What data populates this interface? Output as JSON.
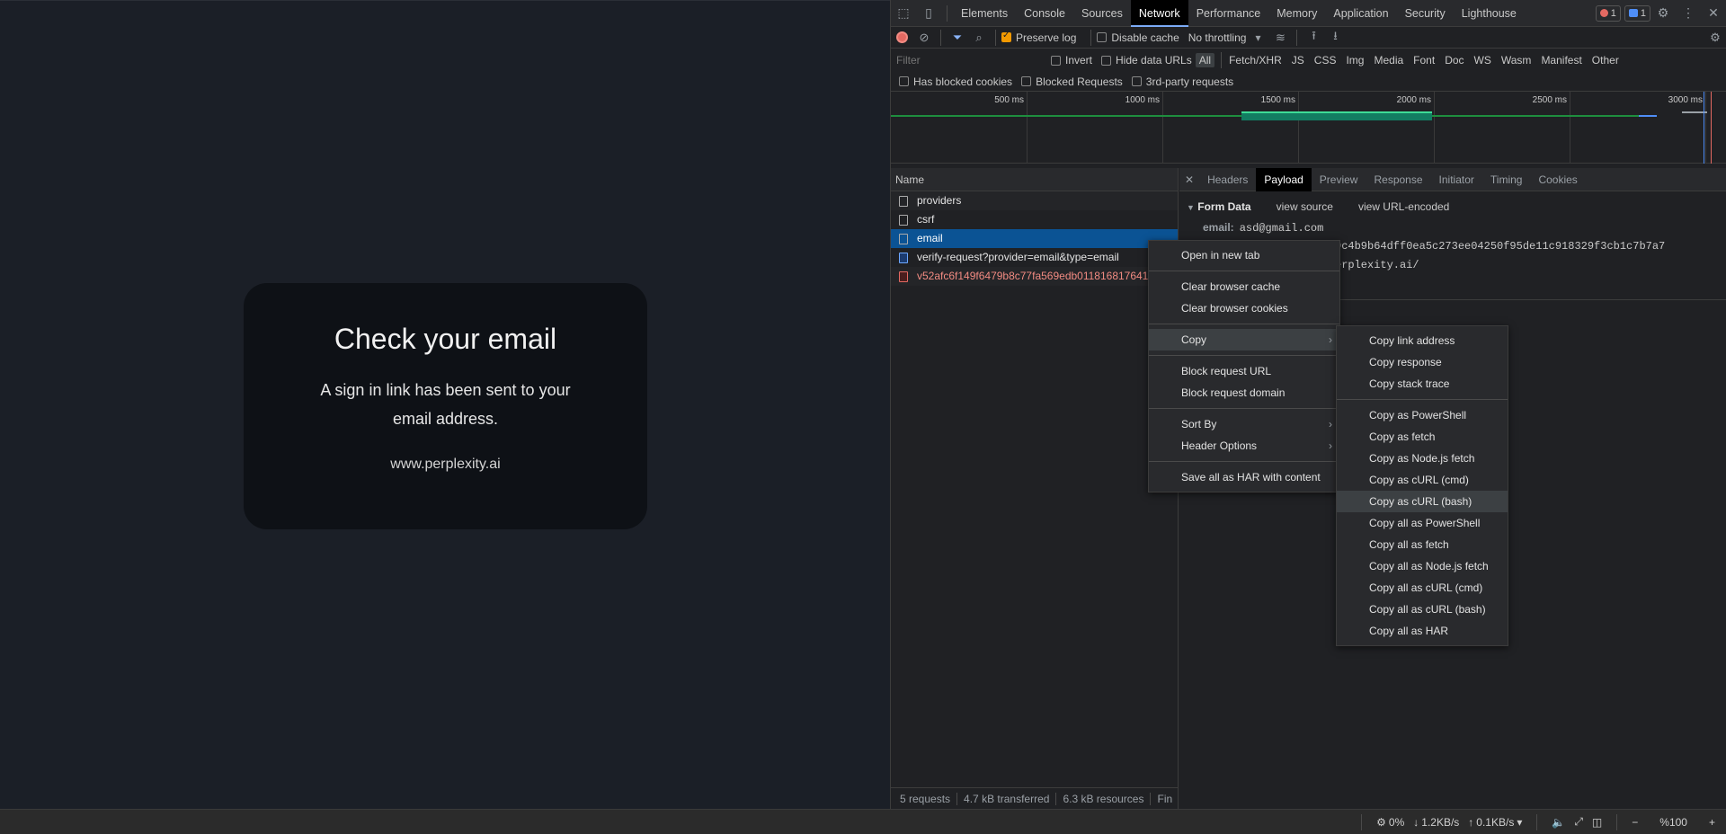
{
  "site": {
    "card_title": "Check your email",
    "card_body": "A sign in link has been sent to your email address.",
    "card_site": "www.perplexity.ai"
  },
  "devtools": {
    "tabs": [
      "Elements",
      "Console",
      "Sources",
      "Network",
      "Performance",
      "Memory",
      "Application",
      "Security",
      "Lighthouse"
    ],
    "active_tab": "Network",
    "error_count": "1",
    "message_count": "1",
    "toolbar": {
      "preserve_log": "Preserve log",
      "disable_cache": "Disable cache",
      "throttling": "No throttling"
    },
    "filter": {
      "placeholder": "Filter",
      "invert": "Invert",
      "hide_data_urls": "Hide data URLs",
      "types": [
        "All",
        "Fetch/XHR",
        "JS",
        "CSS",
        "Img",
        "Media",
        "Font",
        "Doc",
        "WS",
        "Wasm",
        "Manifest",
        "Other"
      ],
      "has_blocked_cookies": "Has blocked cookies",
      "blocked_requests": "Blocked Requests",
      "third_party": "3rd-party requests"
    },
    "overview_ticks": [
      "500 ms",
      "1000 ms",
      "1500 ms",
      "2000 ms",
      "2500 ms",
      "3000 ms"
    ],
    "requests": {
      "header": "Name",
      "items": [
        "providers",
        "csrf",
        "email",
        "verify-request?provider=email&type=email",
        "v52afc6f149f6479b8c77fa569edb0118168176410"
      ]
    },
    "status": {
      "requests": "5 requests",
      "transferred": "4.7 kB transferred",
      "resources": "6.3 kB resources",
      "finish": "Fin"
    },
    "detail_tabs": [
      "Headers",
      "Payload",
      "Preview",
      "Response",
      "Initiator",
      "Timing",
      "Cookies"
    ],
    "payload": {
      "section": "Form Data",
      "view_source": "view source",
      "view_url_encoded": "view URL-encoded",
      "email_key": "email:",
      "email_val": "asd@gmail.com",
      "csrf_partial": "0c4b9b64dff0ea5c273ee04250f95de11c918329f3cb1c7b7a7",
      "callback_partial": "erplexity.ai/"
    }
  },
  "context_menu": {
    "items": [
      "Open in new tab",
      "Clear browser cache",
      "Clear browser cookies",
      "Copy",
      "Block request URL",
      "Block request domain",
      "Sort By",
      "Header Options",
      "Save all as HAR with content"
    ]
  },
  "copy_menu": {
    "items": [
      "Copy link address",
      "Copy response",
      "Copy stack trace",
      "Copy as PowerShell",
      "Copy as fetch",
      "Copy as Node.js fetch",
      "Copy as cURL (cmd)",
      "Copy as cURL (bash)",
      "Copy all as PowerShell",
      "Copy all as fetch",
      "Copy all as Node.js fetch",
      "Copy all as cURL (cmd)",
      "Copy all as cURL (bash)",
      "Copy all as HAR"
    ]
  },
  "taskbar": {
    "cpu": "0%",
    "down": "1.2KB/s",
    "up": "0.1KB/s",
    "zoom": "%100"
  }
}
